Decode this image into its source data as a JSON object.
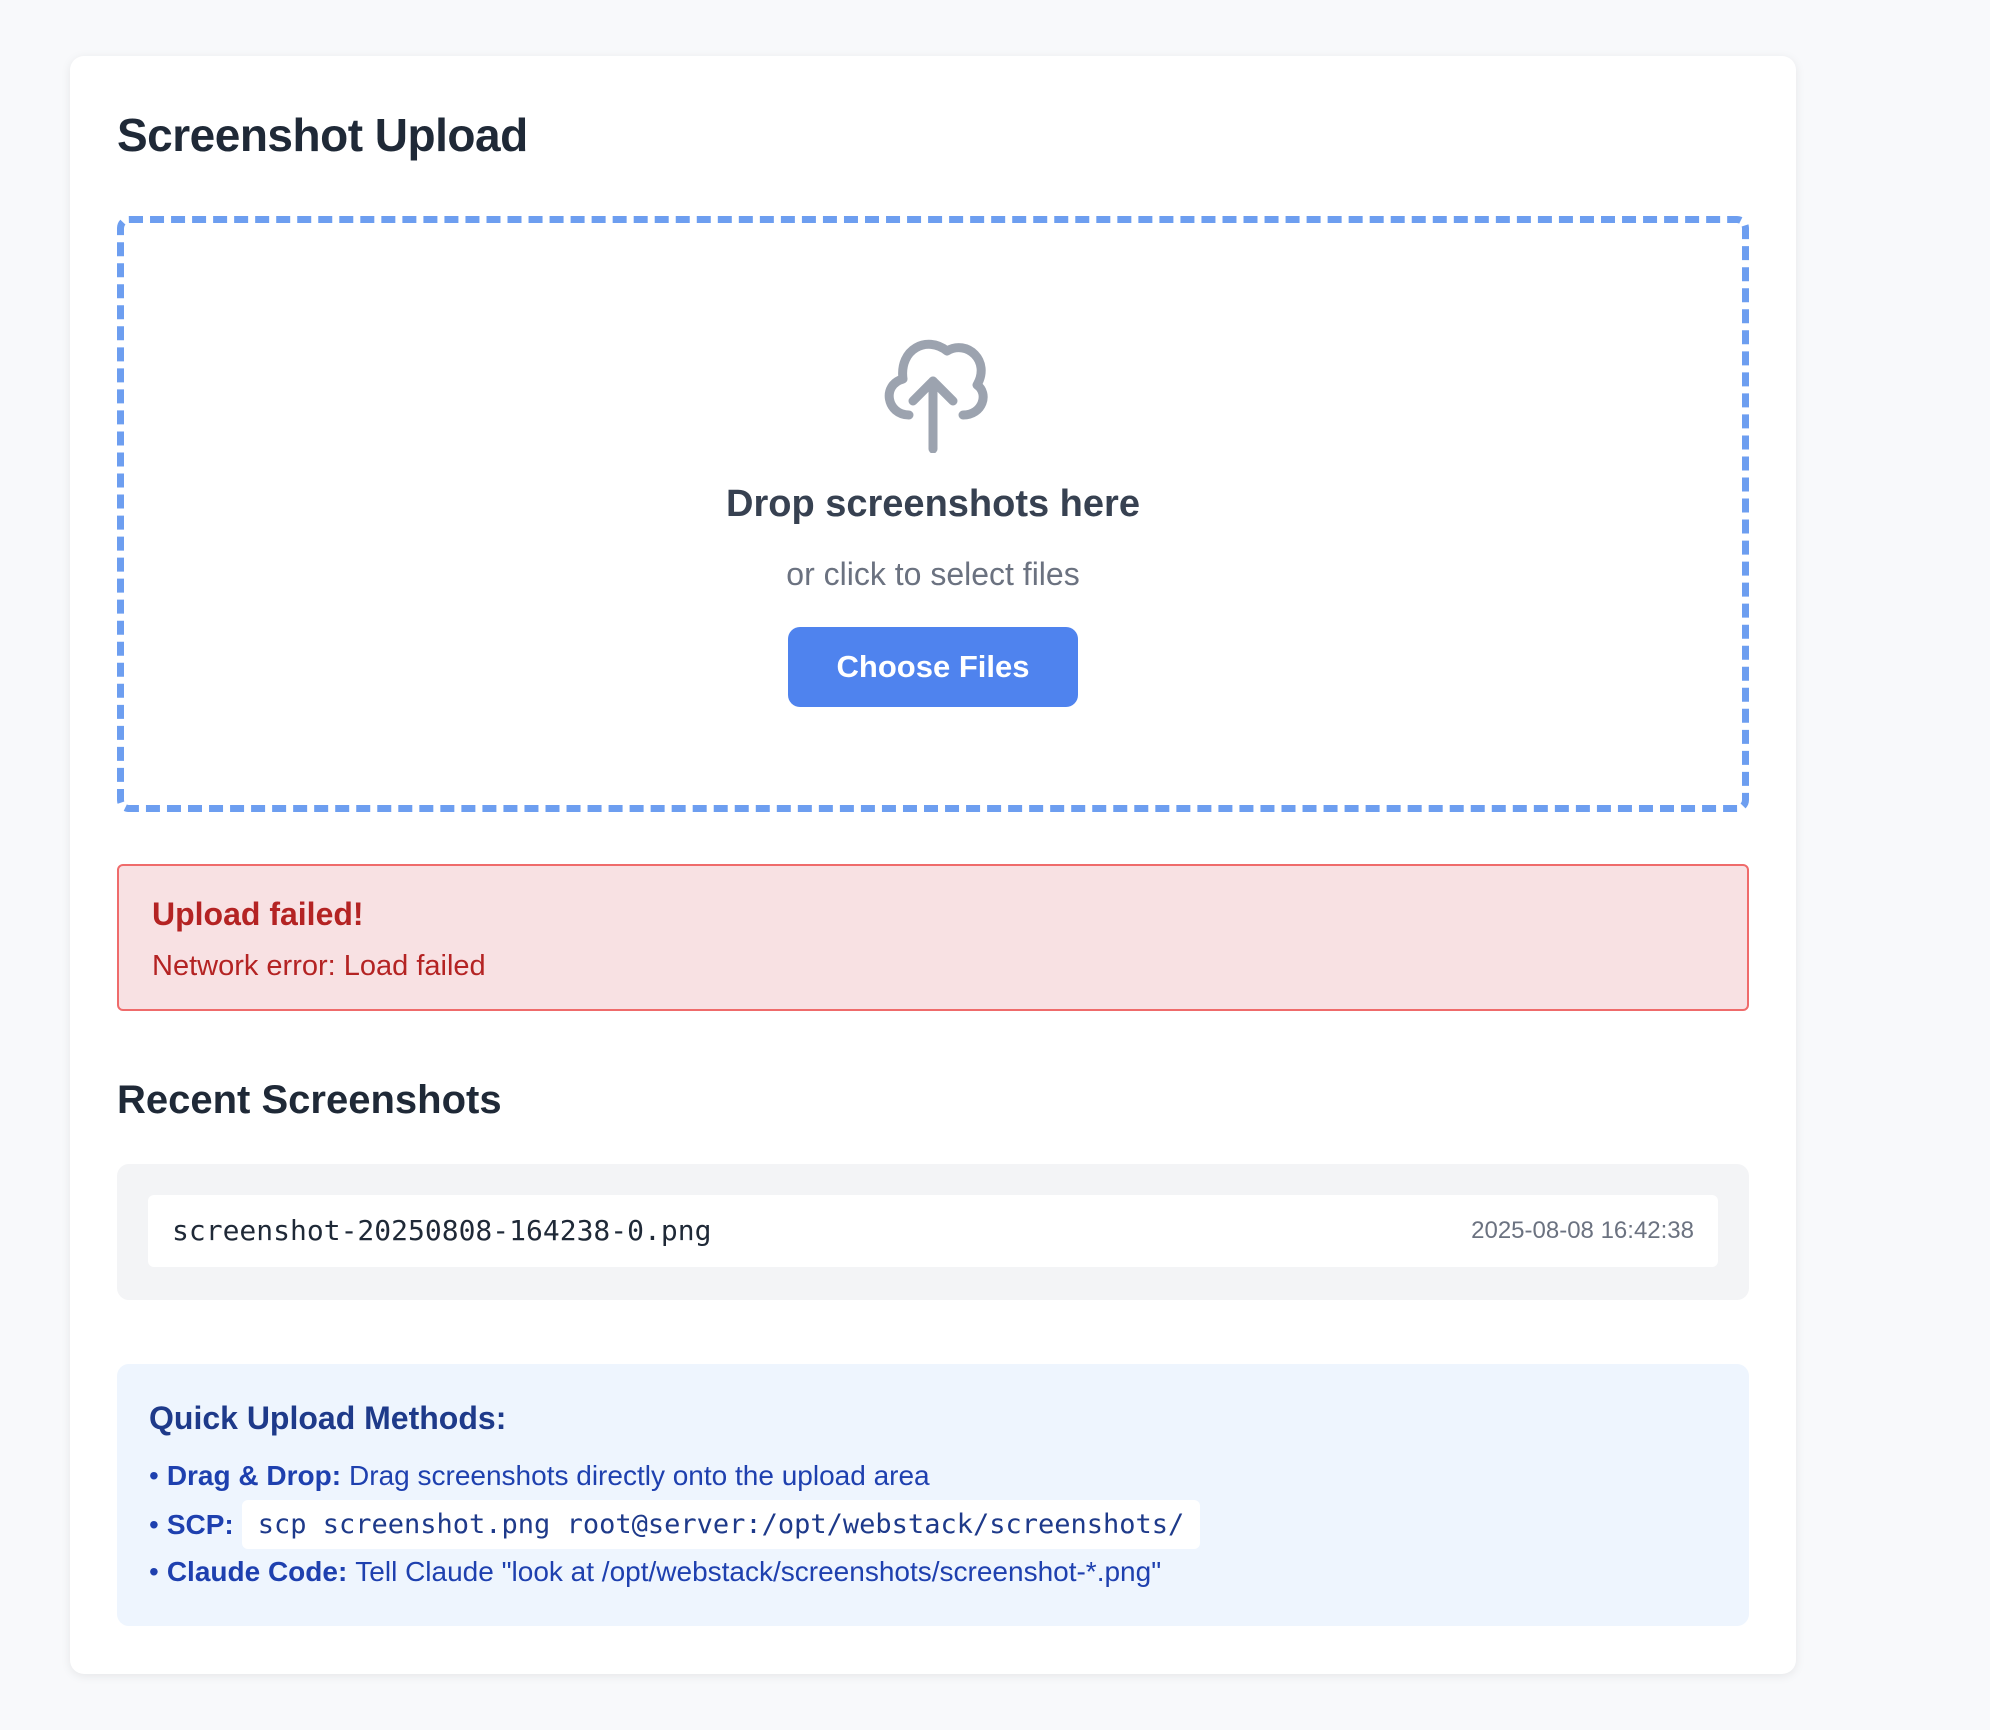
{
  "page": {
    "title": "Screenshot Upload"
  },
  "dropzone": {
    "icon": "cloud-upload-icon",
    "title": "Drop screenshots here",
    "subtitle": "or click to select files",
    "button_label": "Choose Files"
  },
  "error": {
    "title": "Upload failed!",
    "message": "Network error: Load failed"
  },
  "recent": {
    "title": "Recent Screenshots",
    "items": [
      {
        "name": "screenshot-20250808-164238-0.png",
        "timestamp": "2025-08-08 16:42:38"
      }
    ]
  },
  "tips": {
    "title": "Quick Upload Methods:",
    "items": [
      {
        "bullet": "•",
        "label": "Drag & Drop:",
        "text": "Drag screenshots directly onto the upload area"
      },
      {
        "bullet": "•",
        "label": "SCP:",
        "code": "scp screenshot.png root@server:/opt/webstack/screenshots/"
      },
      {
        "bullet": "•",
        "label": "Claude Code:",
        "text": "Tell Claude \"look at /opt/webstack/screenshots/screenshot-*.png\""
      }
    ]
  },
  "colors": {
    "accent": "#4f83ee",
    "dropzone_border": "#6d9ef0",
    "error_bg": "#f8e1e3",
    "error_text": "#b42323",
    "tips_bg": "#eef5fe"
  }
}
